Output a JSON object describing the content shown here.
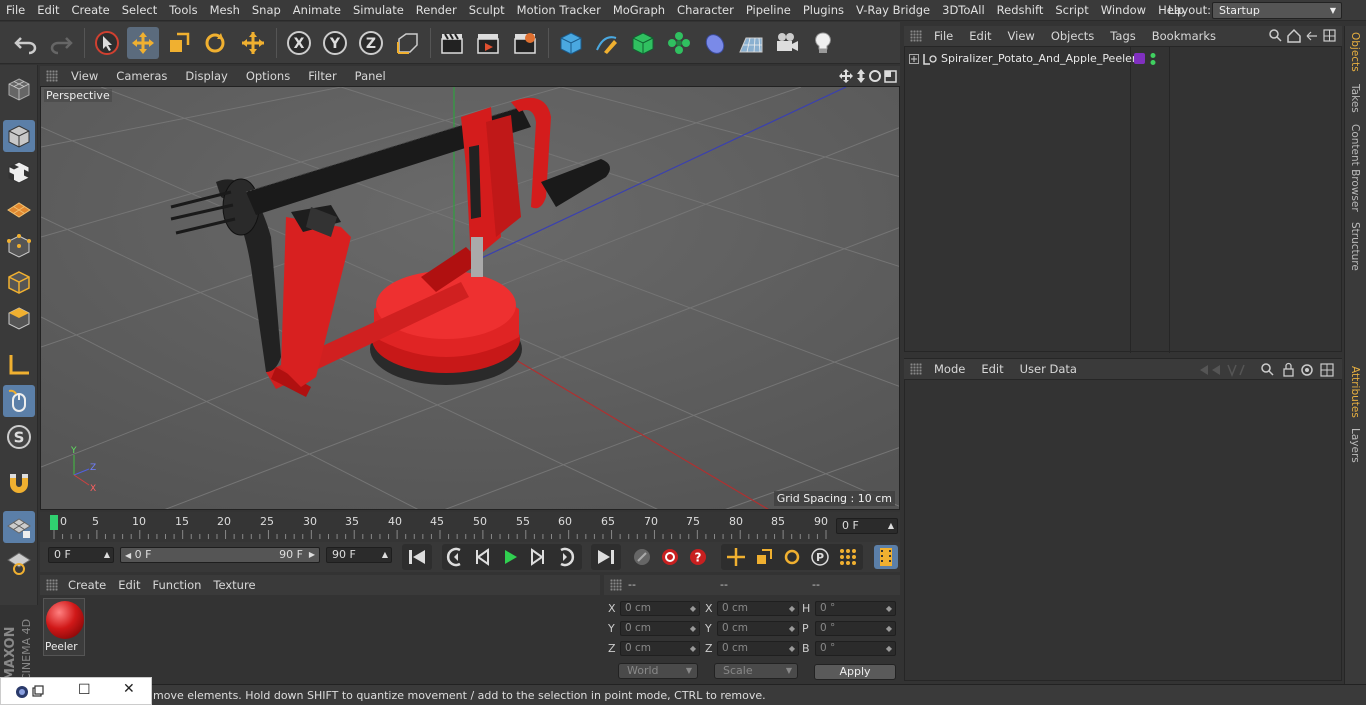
{
  "menu": [
    "File",
    "Edit",
    "Create",
    "Select",
    "Tools",
    "Mesh",
    "Snap",
    "Animate",
    "Simulate",
    "Render",
    "Sculpt",
    "Motion Tracker",
    "MoGraph",
    "Character",
    "Pipeline",
    "Plugins",
    "V-Ray Bridge",
    "3DToAll",
    "Redshift",
    "Script",
    "Window",
    "Help"
  ],
  "layout": {
    "label": "Layout:",
    "value": "Startup"
  },
  "viewport": {
    "menu": [
      "View",
      "Cameras",
      "Display",
      "Options",
      "Filter",
      "Panel"
    ],
    "label": "Perspective",
    "grid_spacing": "Grid Spacing : 10 cm",
    "axis_x": "X",
    "axis_y": "Y",
    "axis_z": "Z"
  },
  "timeline": {
    "ticks": [
      "0",
      "5",
      "10",
      "15",
      "20",
      "25",
      "30",
      "35",
      "40",
      "45",
      "50",
      "55",
      "60",
      "65",
      "70",
      "75",
      "80",
      "85",
      "90"
    ],
    "current_frame": "0 F"
  },
  "playback": {
    "start_frame": "0 F",
    "range_start": "0 F",
    "range_end": "90 F",
    "end_frame": "90 F"
  },
  "material_manager": {
    "menu": [
      "Create",
      "Edit",
      "Function",
      "Texture"
    ],
    "materials": [
      {
        "name": "Peeler",
        "color": "#d01818"
      }
    ]
  },
  "coordinates": {
    "headers": [
      "--",
      "--",
      "--"
    ],
    "rows": [
      {
        "a_label": "X",
        "a_val": "0 cm",
        "b_label": "X",
        "b_val": "0 cm",
        "c_label": "H",
        "c_val": "0 °"
      },
      {
        "a_label": "Y",
        "a_val": "0 cm",
        "b_label": "Y",
        "b_val": "0 cm",
        "c_label": "P",
        "c_val": "0 °"
      },
      {
        "a_label": "Z",
        "a_val": "0 cm",
        "b_label": "Z",
        "b_val": "0 cm",
        "c_label": "B",
        "c_val": "0 °"
      }
    ],
    "space": "World",
    "mode": "Scale",
    "apply": "Apply"
  },
  "objects_manager": {
    "menu": [
      "File",
      "Edit",
      "View",
      "Objects",
      "Tags",
      "Bookmarks"
    ],
    "objects": [
      {
        "name": "Spiralizer_Potato_And_Apple_Peeler"
      }
    ]
  },
  "attributes_manager": {
    "menu": [
      "Mode",
      "Edit",
      "User Data"
    ]
  },
  "side_tabs": [
    "Objects",
    "Takes",
    "Content Browser",
    "Structure"
  ],
  "side_tabs_lower": [
    "Attributes",
    "Layers"
  ],
  "status": "move elements. Hold down SHIFT to quantize movement / add to the selection in point mode, CTRL to remove.",
  "brand": {
    "line1": "MAXON",
    "line2": "CINEMA 4D"
  }
}
